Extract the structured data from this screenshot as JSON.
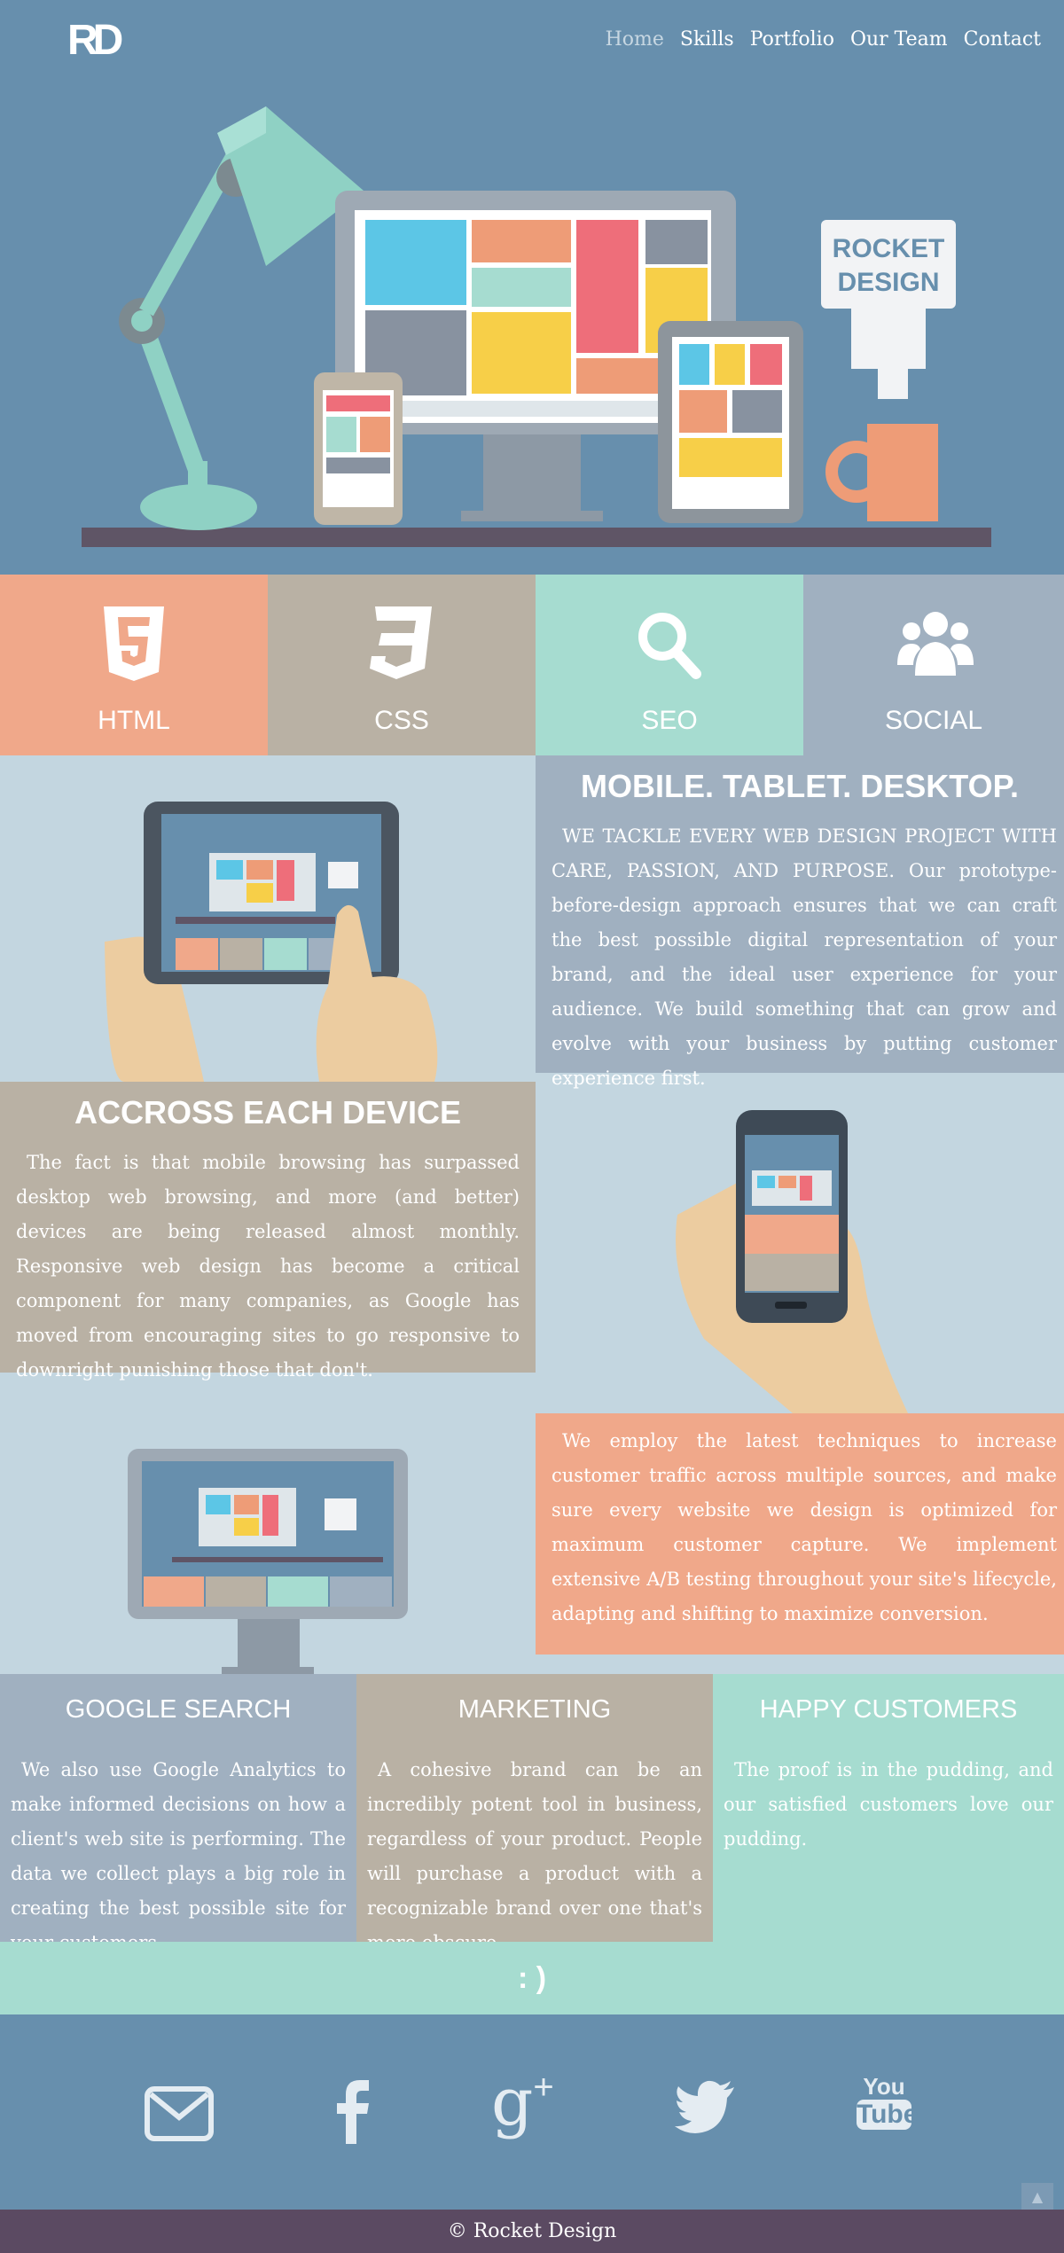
{
  "header": {
    "logo": "RD",
    "nav": [
      "Home",
      "Skills",
      "Portfolio",
      "Our Team",
      "Contact"
    ]
  },
  "hero": {
    "sign_line1": "ROCKET",
    "sign_line2": "DESIGN"
  },
  "tiles": [
    {
      "label": "HTML",
      "icon": "html5-icon",
      "color": "#f0a88a"
    },
    {
      "label": "CSS",
      "icon": "css3-icon",
      "color": "#b9b1a4"
    },
    {
      "label": "SEO",
      "icon": "search-icon",
      "color": "#a6dcd0"
    },
    {
      "label": "SOCIAL",
      "icon": "group-icon",
      "color": "#a0b0c0"
    }
  ],
  "sections": {
    "mobile": {
      "title": "MOBILE. TABLET. DESKTOP.",
      "text": "WE TACKLE EVERY WEB DESIGN PROJECT WITH CARE, PASSION, AND PURPOSE. Our prototype-before-design approach ensures that we can craft the best possible digital representation of your brand, and the ideal user experience for your audience. We build something that can grow and evolve with your business by putting customer experience first."
    },
    "device": {
      "title": "ACCROSS EACH DEVICE",
      "text": "The fact is that mobile browsing has surpassed desktop web browsing, and more (and better) devices are being released almost monthly. Responsive web design has become a critical component for many companies, as Google has moved from encouraging sites to go responsive to downright punishing those that don't."
    },
    "techniques": {
      "text": "We employ the latest techniques to increase customer traffic across multiple sources, and make sure every website we design is optimized for maximum customer capture. We implement extensive A/B testing throughout your site's lifecycle, adapting and shifting to maximize conversion."
    }
  },
  "columns": [
    {
      "title": "GOOGLE SEARCH",
      "text": "We also use Google Analytics to make informed decisions on how a client's web site is performing. The data we collect plays a big role in creating the best possible site for your customers.",
      "color": "#a0b0c0"
    },
    {
      "title": "MARKETING",
      "text": "A cohesive brand can be an incredibly potent tool in business, regardless of your product. People will purchase a product with a recognizable brand over one that's more obscure.",
      "color": "#b9b1a4"
    },
    {
      "title": "HAPPY CUSTOMERS",
      "text": "The proof is in the pudding, and our satisfied customers love our pudding.",
      "color": "#a6dcd0"
    }
  ],
  "smiley": ": )",
  "social": [
    "mail-icon",
    "facebook-icon",
    "google-plus-icon",
    "twitter-icon",
    "youtube-icon"
  ],
  "youtube_text": {
    "line1": "You",
    "line2": "Tube"
  },
  "footer": {
    "copyright": "© Rocket Design"
  },
  "colors": {
    "hero_bg": "#678fad",
    "panel_blue": "#a0b0c0",
    "panel_tan": "#b9b1a4",
    "panel_salmon": "#f0a88a",
    "panel_mint": "#a6dcd0",
    "footer_bar": "#5b4a62"
  }
}
